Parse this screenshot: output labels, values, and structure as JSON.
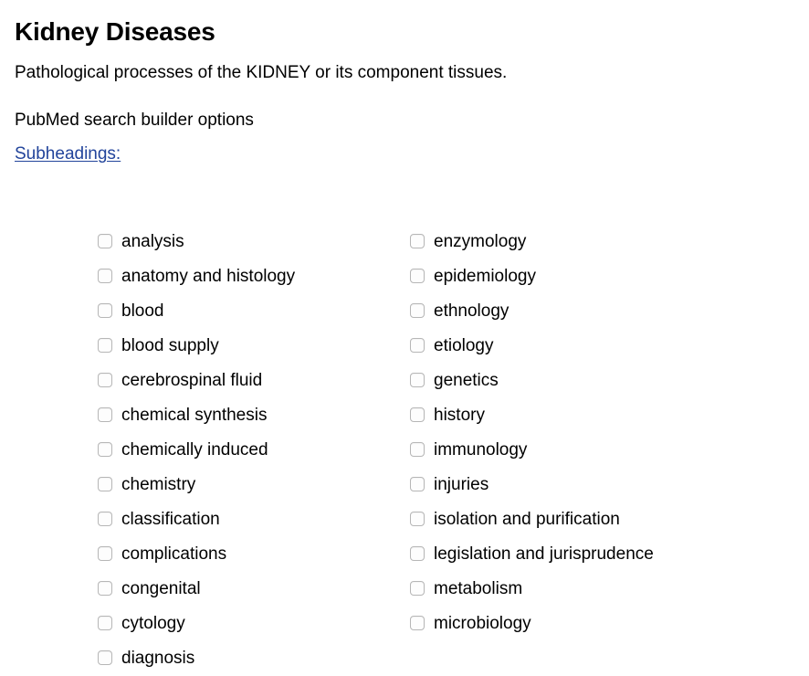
{
  "header": {
    "title": "Kidney Diseases",
    "description": "Pathological processes of the KIDNEY or its component tissues.",
    "builder_options_label": "PubMed search builder options",
    "subheadings_link": "Subheadings:",
    "link_color": "#22449b"
  },
  "subheadings": {
    "left_column": [
      {
        "label": "analysis",
        "checked": false
      },
      {
        "label": "anatomy and histology",
        "checked": false
      },
      {
        "label": "blood",
        "checked": false
      },
      {
        "label": "blood supply",
        "checked": false
      },
      {
        "label": "cerebrospinal fluid",
        "checked": false
      },
      {
        "label": "chemical synthesis",
        "checked": false
      },
      {
        "label": "chemically induced",
        "checked": false
      },
      {
        "label": "chemistry",
        "checked": false
      },
      {
        "label": "classification",
        "checked": false
      },
      {
        "label": "complications",
        "checked": false
      },
      {
        "label": "congenital",
        "checked": false
      },
      {
        "label": "cytology",
        "checked": false
      },
      {
        "label": "diagnosis",
        "checked": false
      }
    ],
    "right_column": [
      {
        "label": "enzymology",
        "checked": false
      },
      {
        "label": "epidemiology",
        "checked": false
      },
      {
        "label": "ethnology",
        "checked": false
      },
      {
        "label": "etiology",
        "checked": false
      },
      {
        "label": "genetics",
        "checked": false
      },
      {
        "label": "history",
        "checked": false
      },
      {
        "label": "immunology",
        "checked": false
      },
      {
        "label": "injuries",
        "checked": false
      },
      {
        "label": "isolation and purification",
        "checked": false
      },
      {
        "label": "legislation and jurisprudence",
        "checked": false
      },
      {
        "label": "metabolism",
        "checked": false
      },
      {
        "label": "microbiology",
        "checked": false
      }
    ]
  }
}
